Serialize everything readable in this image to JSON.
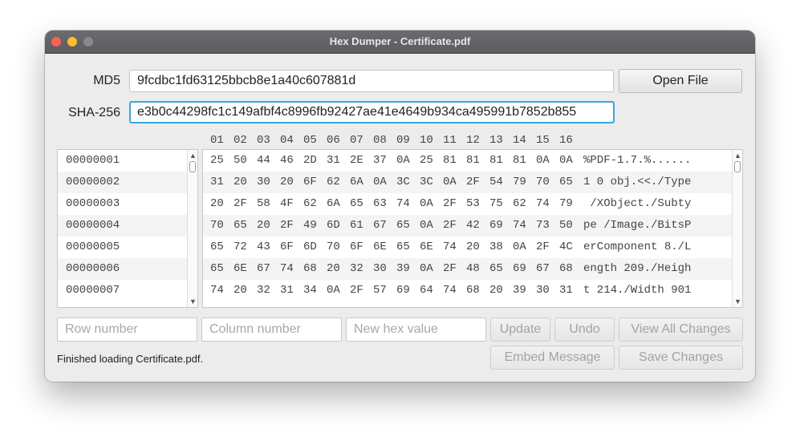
{
  "window": {
    "title": "Hex Dumper - Certificate.pdf"
  },
  "md5": {
    "label": "MD5",
    "value": "9fcdbc1fd63125bbcb8e1a40c607881d"
  },
  "sha256": {
    "label": "SHA-256",
    "value": "e3b0c44298fc1c149afbf4c8996fb92427ae41e4649b934ca495991b7852b855"
  },
  "buttons": {
    "open_file": "Open File",
    "update": "Update",
    "undo": "Undo",
    "view_all_changes": "View All Changes",
    "embed_message": "Embed Message",
    "save_changes": "Save Changes"
  },
  "inputs": {
    "row_placeholder": "Row number",
    "column_placeholder": "Column number",
    "hex_placeholder": "New hex value"
  },
  "columns": [
    "01",
    "02",
    "03",
    "04",
    "05",
    "06",
    "07",
    "08",
    "09",
    "10",
    "11",
    "12",
    "13",
    "14",
    "15",
    "16"
  ],
  "rows": [
    {
      "offset": "00000001",
      "hex": [
        "25",
        "50",
        "44",
        "46",
        "2D",
        "31",
        "2E",
        "37",
        "0A",
        "25",
        "81",
        "81",
        "81",
        "81",
        "0A",
        "0A"
      ],
      "ascii": "%PDF-1.7.%......"
    },
    {
      "offset": "00000002",
      "hex": [
        "31",
        "20",
        "30",
        "20",
        "6F",
        "62",
        "6A",
        "0A",
        "3C",
        "3C",
        "0A",
        "2F",
        "54",
        "79",
        "70",
        "65"
      ],
      "ascii": "1 0 obj.<<./Type"
    },
    {
      "offset": "00000003",
      "hex": [
        "20",
        "2F",
        "58",
        "4F",
        "62",
        "6A",
        "65",
        "63",
        "74",
        "0A",
        "2F",
        "53",
        "75",
        "62",
        "74",
        "79"
      ],
      "ascii": " /XObject./Subty"
    },
    {
      "offset": "00000004",
      "hex": [
        "70",
        "65",
        "20",
        "2F",
        "49",
        "6D",
        "61",
        "67",
        "65",
        "0A",
        "2F",
        "42",
        "69",
        "74",
        "73",
        "50"
      ],
      "ascii": "pe /Image./BitsP"
    },
    {
      "offset": "00000005",
      "hex": [
        "65",
        "72",
        "43",
        "6F",
        "6D",
        "70",
        "6F",
        "6E",
        "65",
        "6E",
        "74",
        "20",
        "38",
        "0A",
        "2F",
        "4C"
      ],
      "ascii": "erComponent 8./L"
    },
    {
      "offset": "00000006",
      "hex": [
        "65",
        "6E",
        "67",
        "74",
        "68",
        "20",
        "32",
        "30",
        "39",
        "0A",
        "2F",
        "48",
        "65",
        "69",
        "67",
        "68"
      ],
      "ascii": "ength 209./Heigh"
    },
    {
      "offset": "00000007",
      "hex": [
        "74",
        "20",
        "32",
        "31",
        "34",
        "0A",
        "2F",
        "57",
        "69",
        "64",
        "74",
        "68",
        "20",
        "39",
        "30",
        "31"
      ],
      "ascii": "t 214./Width 901"
    }
  ],
  "status": "Finished loading Certificate.pdf."
}
